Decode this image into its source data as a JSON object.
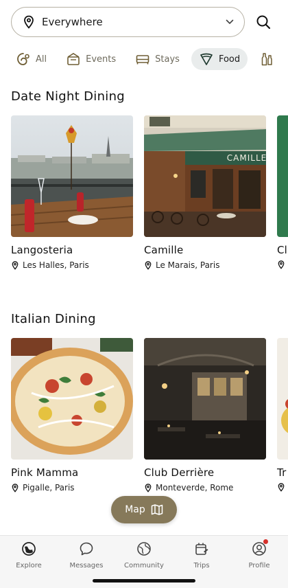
{
  "search": {
    "location": "Everywhere"
  },
  "categories": [
    {
      "label": "All",
      "icon": "swirl-icon",
      "active": false
    },
    {
      "label": "Events",
      "icon": "event-tent-icon",
      "active": false
    },
    {
      "label": "Stays",
      "icon": "bed-icon",
      "active": false
    },
    {
      "label": "Food",
      "icon": "food-slice-icon",
      "active": true
    },
    {
      "label": "",
      "icon": "bottles-icon",
      "active": false
    }
  ],
  "sections": [
    {
      "title": "Date Night Dining",
      "cards": [
        {
          "name": "Langosteria",
          "location": "Les Halles, Paris"
        },
        {
          "name": "Camille",
          "location": "Le Marais, Paris"
        },
        {
          "name": "Cl",
          "location": ""
        }
      ]
    },
    {
      "title": "Italian Dining",
      "cards": [
        {
          "name": "Pink Mamma",
          "location": "Pigalle, Paris"
        },
        {
          "name": "Club Derrière",
          "location": "Monteverde, Rome"
        },
        {
          "name": "Tr",
          "location": ""
        }
      ]
    }
  ],
  "camille_sign": "CAMILLE",
  "map_button": {
    "label": "Map"
  },
  "tabs": [
    {
      "label": "Explore",
      "icon": "compass-globe-icon"
    },
    {
      "label": "Messages",
      "icon": "chat-bubble-icon"
    },
    {
      "label": "Community",
      "icon": "globe-icon"
    },
    {
      "label": "Trips",
      "icon": "luggage-icon"
    },
    {
      "label": "Profile",
      "icon": "profile-icon",
      "badge": true
    }
  ],
  "colors": {
    "accent": "#86795a",
    "badge": "#d6312b",
    "chip_active": "#e9ecec"
  }
}
